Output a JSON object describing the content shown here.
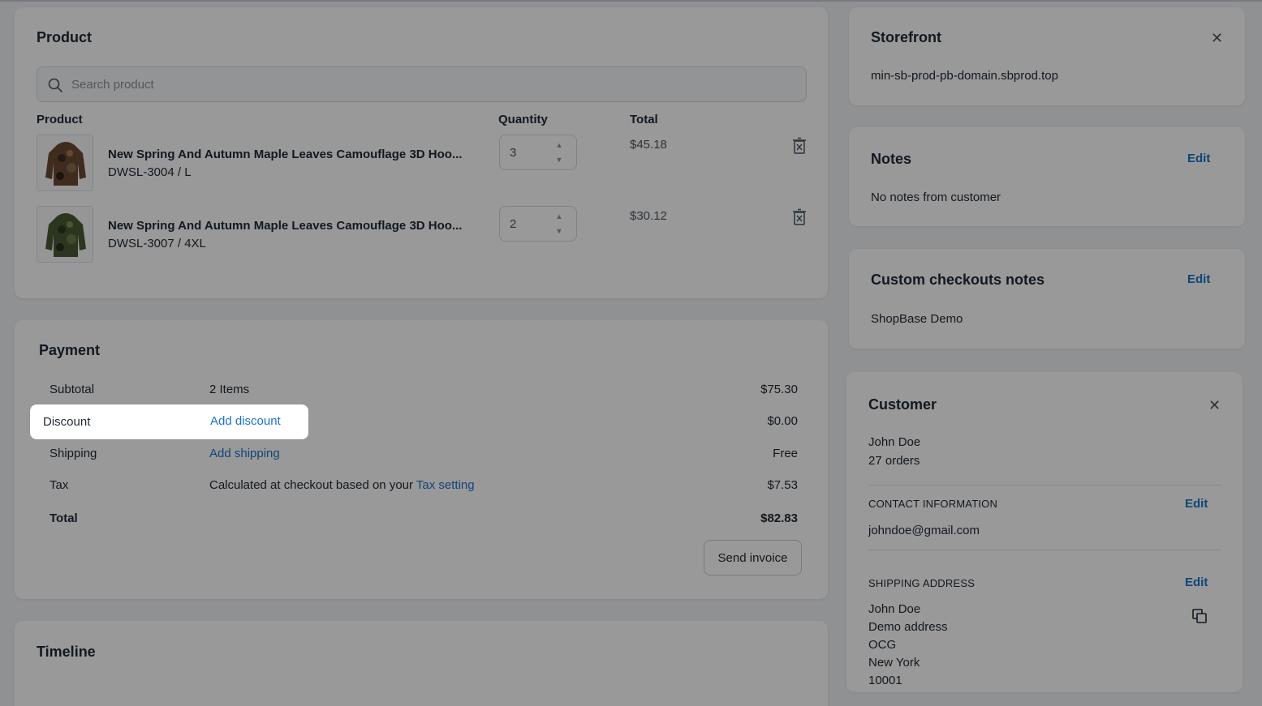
{
  "product_card": {
    "title": "Product",
    "search_placeholder": "Search product",
    "columns": {
      "product": "Product",
      "quantity": "Quantity",
      "total": "Total"
    },
    "items": [
      {
        "name": "New Spring And Autumn Maple Leaves Camouflage 3D Hoo...",
        "sku": "DWSL-3004 / L",
        "quantity": "3",
        "total": "$45.18",
        "thumb_color": "#5b3a26"
      },
      {
        "name": "New Spring And Autumn Maple Leaves Camouflage 3D Hoo...",
        "sku": "DWSL-3007 / 4XL",
        "quantity": "2",
        "total": "$30.12",
        "thumb_color": "#3b4a2a"
      }
    ]
  },
  "payment_card": {
    "title": "Payment",
    "rows": {
      "subtotal": {
        "label": "Subtotal",
        "mid": "2 Items",
        "value": "$75.30"
      },
      "discount": {
        "label": "Discount",
        "link": "Add discount",
        "value": "$0.00"
      },
      "shipping": {
        "label": "Shipping",
        "link": "Add shipping",
        "value": "Free"
      },
      "tax": {
        "label": "Tax",
        "mid": "Calculated at checkout based on your",
        "link": "Tax setting",
        "value": "$7.53"
      },
      "total": {
        "label": "Total",
        "value": "$82.83"
      }
    },
    "send_invoice": "Send invoice"
  },
  "timeline_card": {
    "title": "Timeline"
  },
  "storefront_card": {
    "title": "Storefront",
    "domain": "min-sb-prod-pb-domain.sbprod.top"
  },
  "notes_card": {
    "title": "Notes",
    "edit": "Edit",
    "text": "No notes from customer"
  },
  "custom_notes_card": {
    "title": "Custom checkouts notes",
    "edit": "Edit",
    "text": "ShopBase Demo"
  },
  "customer_card": {
    "title": "Customer",
    "name": "John Doe",
    "orders": "27 orders",
    "contact": {
      "caption": "CONTACT INFORMATION",
      "edit": "Edit",
      "email": "johndoe@gmail.com"
    },
    "shipping": {
      "caption": "SHIPPING ADDRESS",
      "edit": "Edit",
      "lines": [
        "John Doe",
        "Demo address",
        "OCG",
        "New York",
        "10001"
      ]
    }
  },
  "colors": {
    "link": "#1a73c9",
    "background": "#f1f2f4"
  }
}
